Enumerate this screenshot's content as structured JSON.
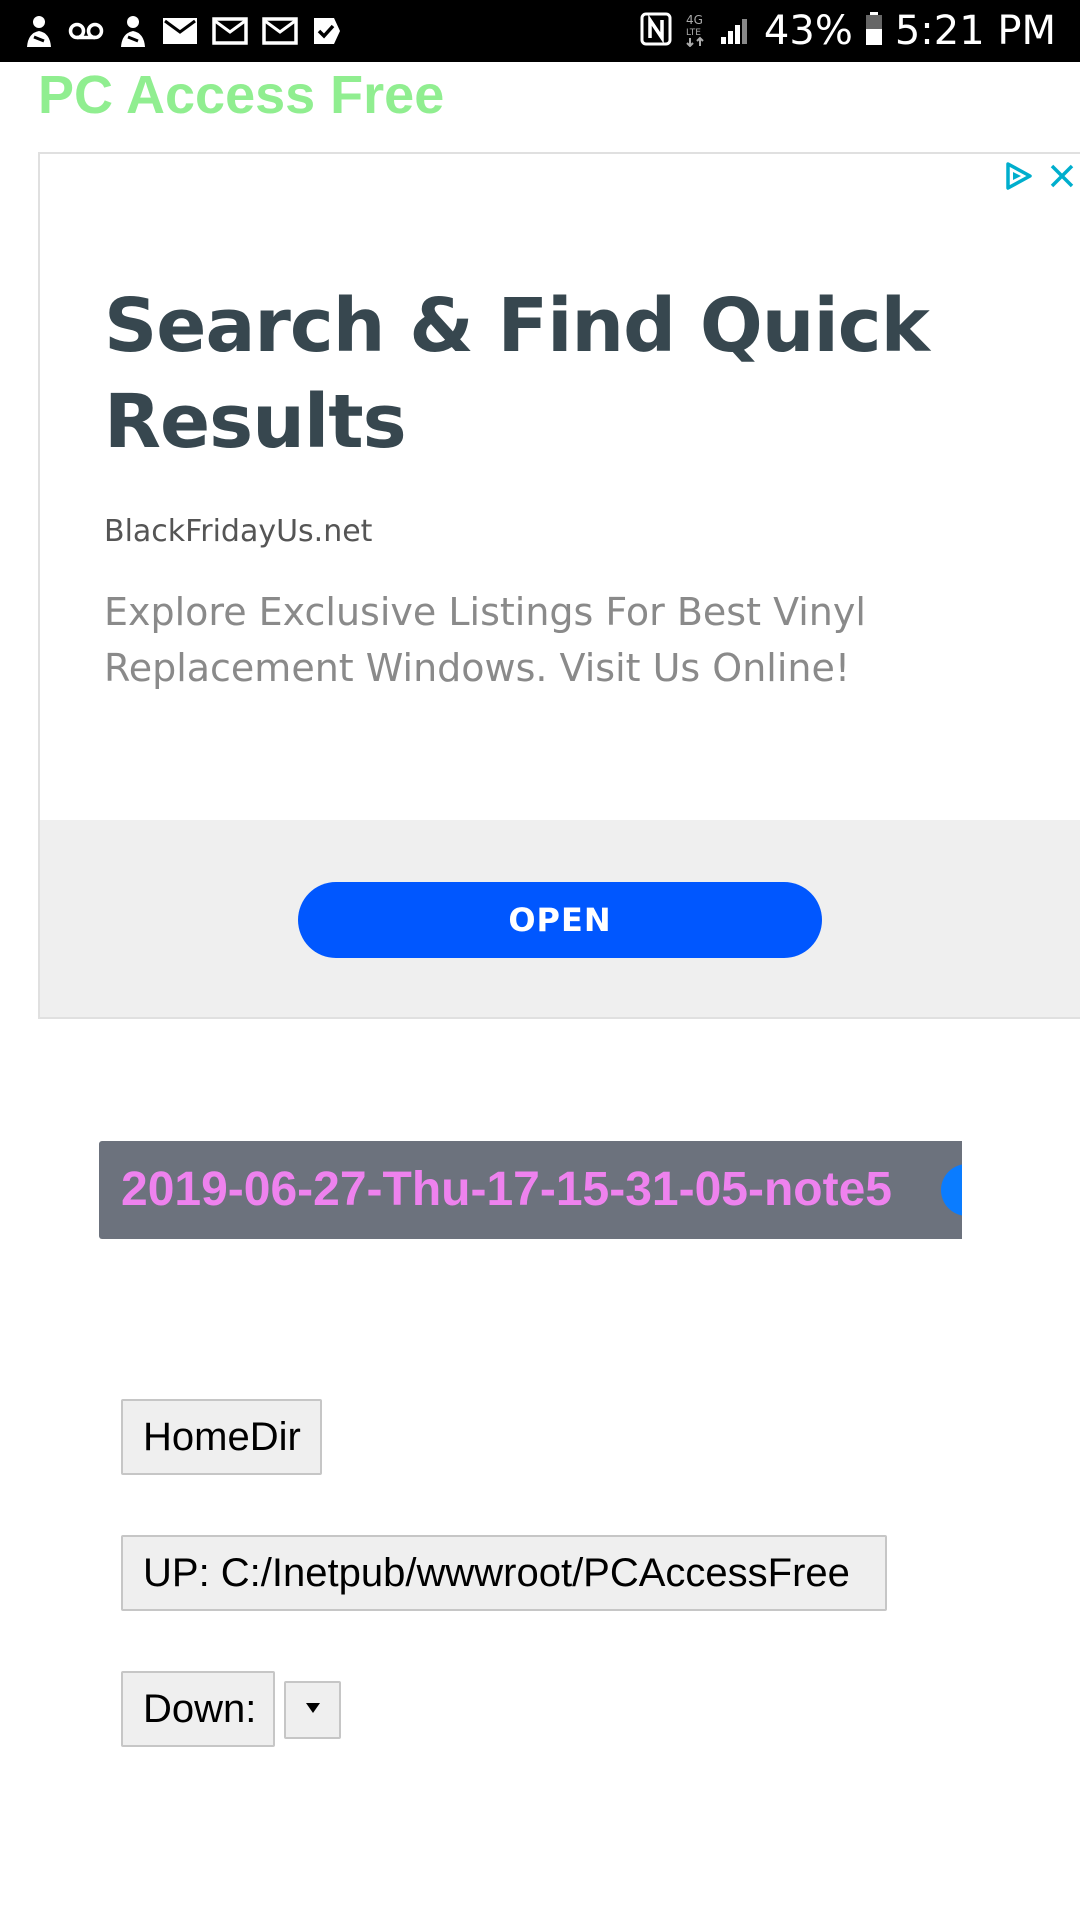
{
  "status_bar": {
    "battery_percent": "43%",
    "time": "5:21 PM",
    "left_icons": [
      "account-icon",
      "voicemail-icon",
      "account-icon",
      "mail-icon",
      "mail-icon",
      "mail-icon",
      "checklist-icon"
    ],
    "right_icons": [
      "nfc-icon",
      "data-4g-icon",
      "signal-icon",
      "battery-icon"
    ]
  },
  "page": {
    "title": "PC Access Free",
    "title_color": "#90ee90"
  },
  "ad": {
    "headline": "Search & Find Quick Results",
    "domain": "BlackFridayUs.net",
    "description": "Explore Exclusive Listings For Best Vinyl Replacement Windows. Visit Us Online!",
    "cta_label": "OPEN",
    "cta_color": "#0057ff",
    "badges": [
      "ad-choices-icon",
      "close-icon"
    ]
  },
  "file_banner": {
    "name": "2019-06-27-Thu-17-15-31-05-note5",
    "name_color": "#ee82ee"
  },
  "navigation": {
    "homedir_label": "HomeDir",
    "up_label": "UP: C:/Inetpub/wwwroot/PCAccessFree",
    "down_label": "Down:",
    "down_select_icon": "dropdown-arrow-icon"
  }
}
